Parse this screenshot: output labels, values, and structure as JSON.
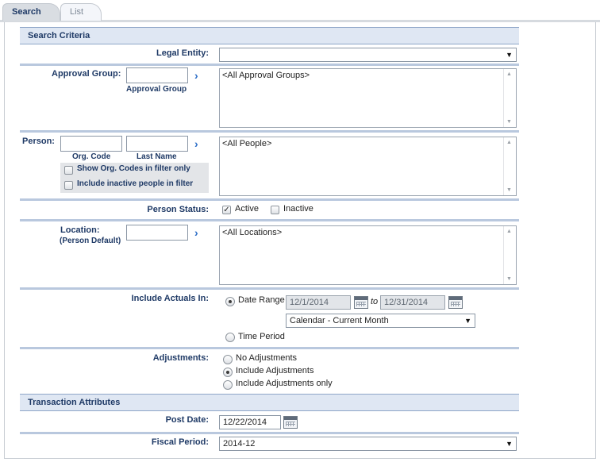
{
  "tabs": [
    {
      "label": "Search",
      "active": true
    },
    {
      "label": "List",
      "active": false
    }
  ],
  "sections": {
    "search_criteria": "Search Criteria",
    "transaction_attributes": "Transaction Attributes"
  },
  "legal_entity": {
    "label": "Legal Entity:",
    "value": ""
  },
  "approval_group": {
    "label": "Approval Group:",
    "sublabel": "Approval Group",
    "input_value": "",
    "list_items": [
      "<All Approval Groups>"
    ]
  },
  "person": {
    "label": "Person:",
    "org_code_label": "Org. Code",
    "last_name_label": "Last Name",
    "org_code_value": "",
    "last_name_value": "",
    "show_org_codes": {
      "label": "Show Org. Codes in filter only",
      "checked": false
    },
    "include_inactive": {
      "label": "Include inactive people in filter",
      "checked": false
    },
    "list_items": [
      "<All People>"
    ]
  },
  "person_status": {
    "label": "Person Status:",
    "active": {
      "label": "Active",
      "checked": true
    },
    "inactive": {
      "label": "Inactive",
      "checked": false
    }
  },
  "location": {
    "label": "Location:",
    "sublabel": "(Person Default)",
    "input_value": "",
    "list_items": [
      "<All Locations>"
    ]
  },
  "include_actuals": {
    "label": "Include Actuals In:",
    "date_range": {
      "label": "Date Range",
      "selected": true,
      "from": "12/1/2014",
      "to_label": "to",
      "to": "12/31/2014"
    },
    "period_select": "Calendar - Current Month",
    "time_period": {
      "label": "Time Period",
      "selected": false
    }
  },
  "adjustments": {
    "label": "Adjustments:",
    "options": [
      {
        "label": "No Adjustments",
        "selected": false
      },
      {
        "label": "Include Adjustments",
        "selected": true
      },
      {
        "label": "Include Adjustments only",
        "selected": false
      }
    ]
  },
  "post_date": {
    "label": "Post Date:",
    "value": "12/22/2014"
  },
  "fiscal_period": {
    "label": "Fiscal Period:",
    "value": "2014-12"
  },
  "icons": {
    "dropdown": "triangle-down-icon",
    "lookup": "chevron-right-icon",
    "calendar": "calendar-icon"
  },
  "colors": {
    "label": "#1f3a66",
    "section_bg": "#dfe7f3",
    "separator": "#b9c8de",
    "lookup_arrow": "#2a6cc6"
  }
}
